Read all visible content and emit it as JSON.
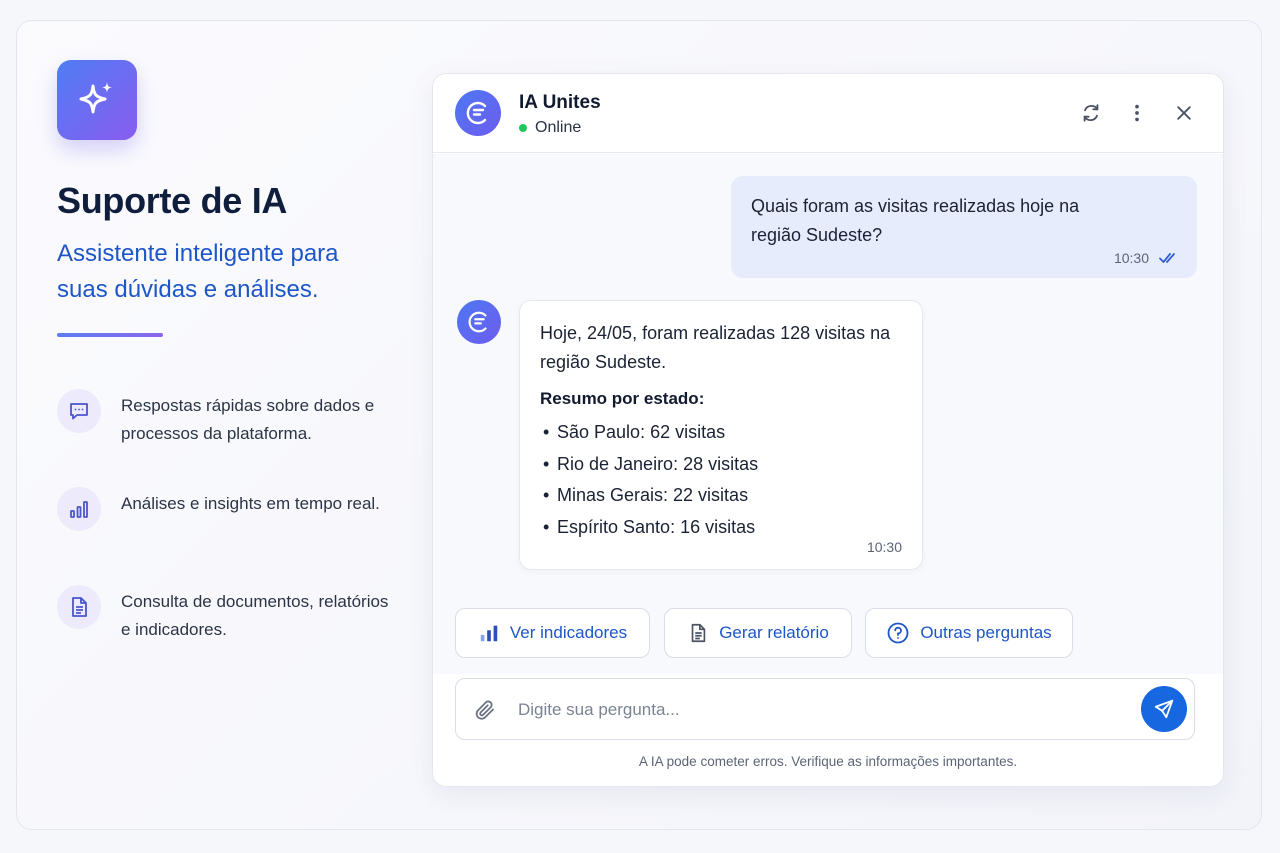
{
  "left_panel": {
    "title": "Suporte de IA",
    "subtitle": "Assistente inteligente para suas dúvidas e análises.",
    "features": [
      {
        "icon": "chat-bubble-icon",
        "text": "Respostas rápidas sobre dados e processos da plataforma."
      },
      {
        "icon": "bar-chart-icon",
        "text": "Análises e insights em tempo real."
      },
      {
        "icon": "document-icon",
        "text": "Consulta de documentos, relatórios e indicadores."
      }
    ],
    "logo_icon": "sparkles-icon"
  },
  "chat": {
    "bot_name": "IA Unites",
    "status": "Online",
    "header_actions": [
      "refresh-icon",
      "more-vertical-icon",
      "close-icon"
    ],
    "messages": {
      "user": {
        "text": "Quais foram as visitas realizadas hoje na região Sudeste?",
        "time": "10:30"
      },
      "bot": {
        "intro": "Hoje, 24/05, foram realizadas 128 visitas na região Sudeste.",
        "summary_title": "Resumo por estado:",
        "items": [
          "São Paulo: 62 visitas",
          "Rio de Janeiro: 28 visitas",
          "Minas Gerais: 22 visitas",
          "Espírito Santo: 16 visitas"
        ],
        "time": "10:30"
      }
    },
    "quick_actions": [
      {
        "label": "Ver indicadores",
        "icon": "bar-chart-icon"
      },
      {
        "label": "Gerar relatório",
        "icon": "document-icon"
      },
      {
        "label": "Outras perguntas",
        "icon": "help-circle-icon"
      }
    ],
    "input": {
      "placeholder": "Digite sua pergunta...",
      "value": ""
    },
    "disclaimer": "A IA pode cometer erros. Verifique as informações importantes."
  },
  "colors": {
    "accent": "#1d56c8",
    "send_button": "#1667e0",
    "user_bubble": "#e7ecfd",
    "online": "#22c55e",
    "gradient_start": "#4f7df3",
    "gradient_end": "#8a5cf0"
  }
}
